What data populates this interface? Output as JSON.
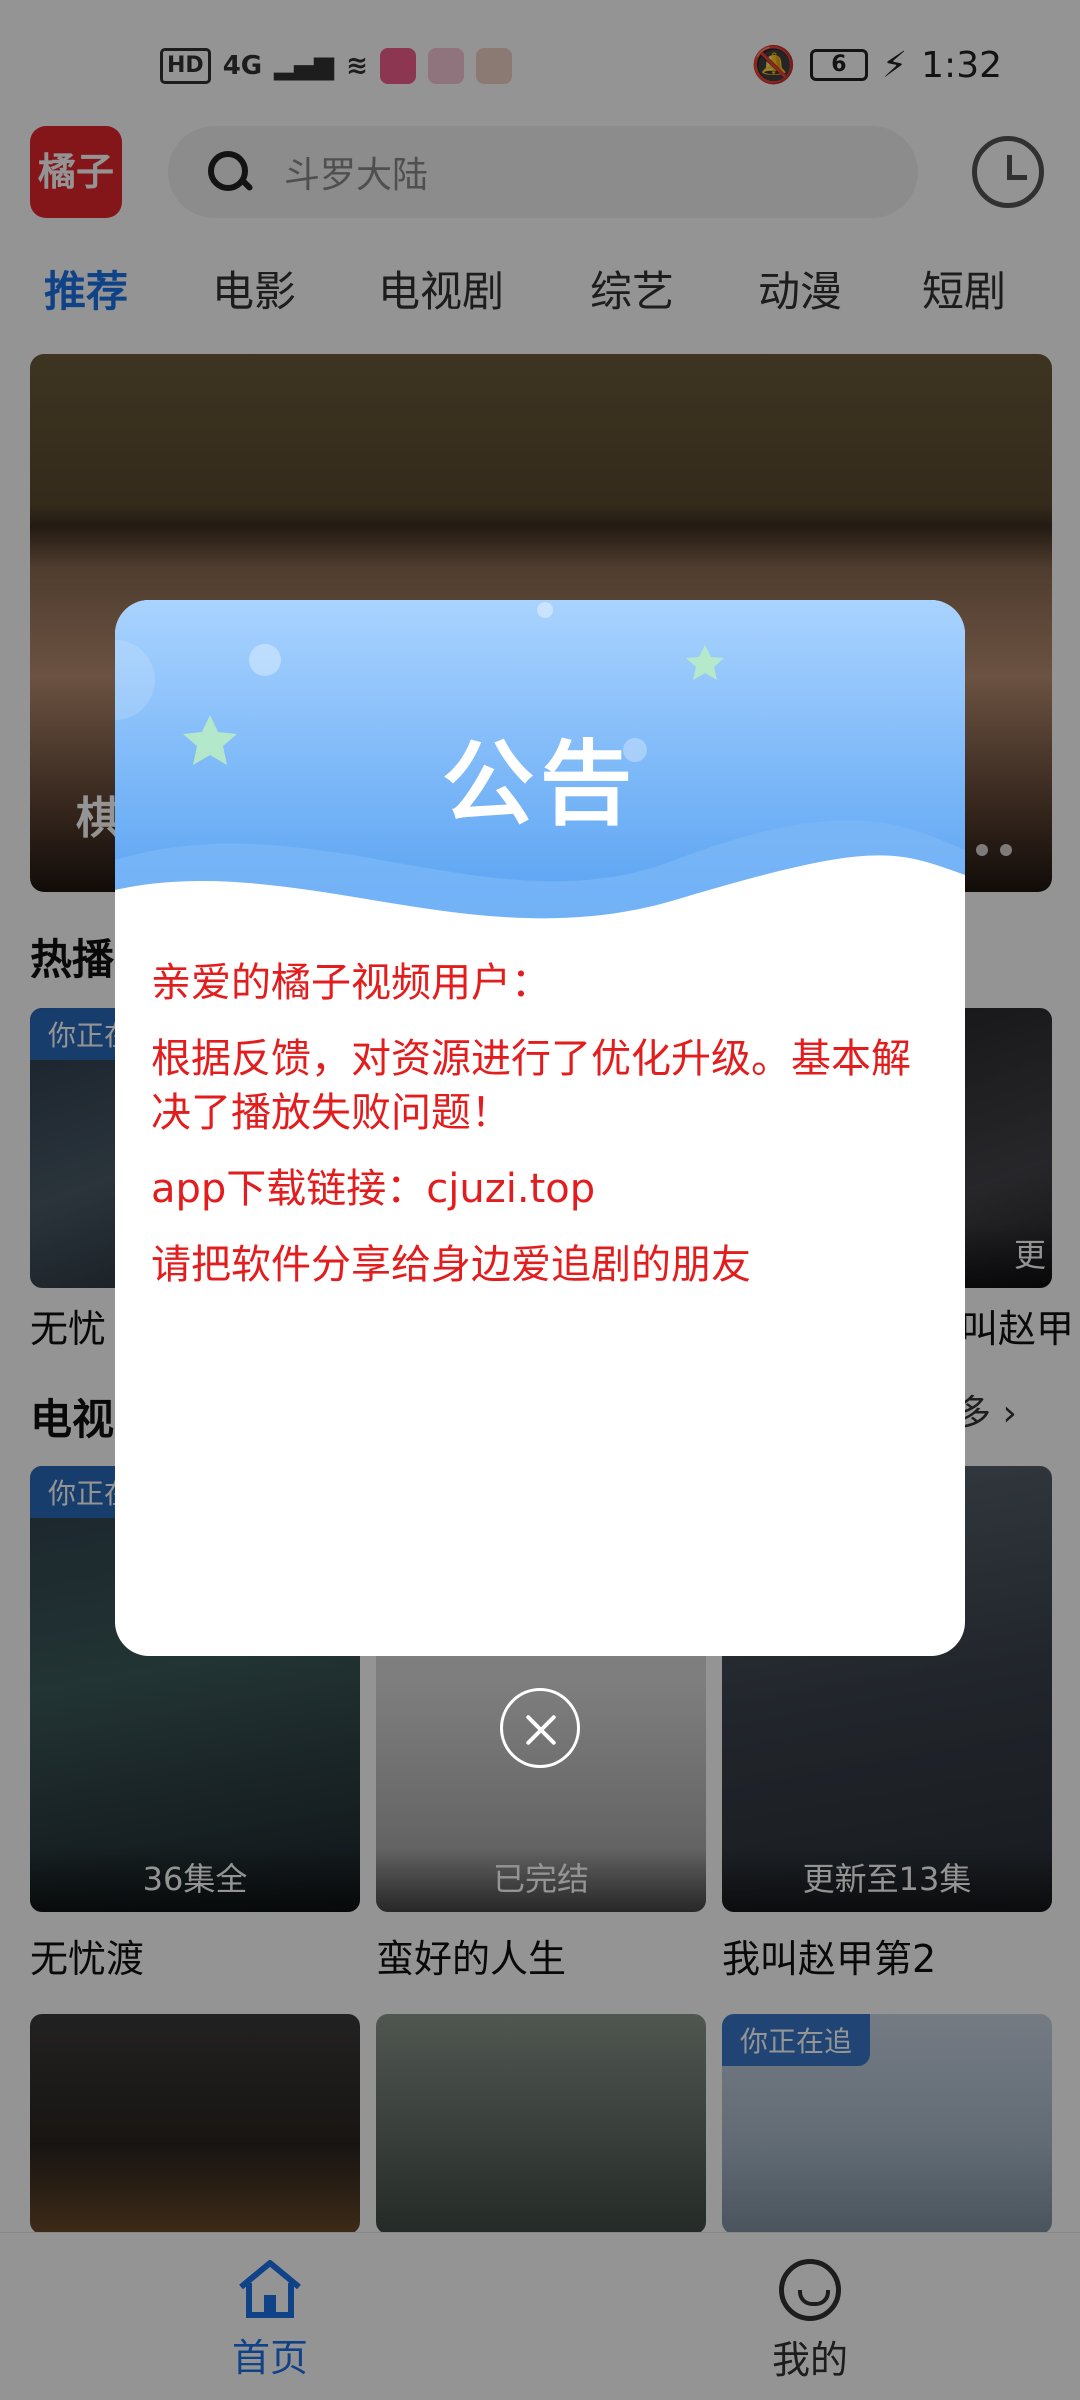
{
  "status_bar": {
    "hd": "HD",
    "signal": "4G",
    "battery": "6",
    "time": "1:32"
  },
  "header": {
    "logo_text": "橘子",
    "search_placeholder": "斗罗大陆"
  },
  "tabs": [
    "推荐",
    "电影",
    "电视剧",
    "综艺",
    "动漫",
    "短剧"
  ],
  "banner": {
    "title": "棋"
  },
  "sections": [
    {
      "title": "热播",
      "more": ""
    },
    {
      "title": "电视",
      "more": "多"
    }
  ],
  "hot_row": {
    "tag": "你正在",
    "left_title": "无忧",
    "right_title": "叫赵甲",
    "right_caption": "更"
  },
  "tv_row": [
    {
      "tag": "你正在",
      "caption": "36集全",
      "title": "无忧渡"
    },
    {
      "tag": "",
      "caption": "已完结",
      "title": "蛮好的人生"
    },
    {
      "tag": "",
      "caption": "更新至13集",
      "title": "我叫赵甲第2"
    }
  ],
  "bottom_row": [
    {
      "tag": ""
    },
    {
      "tag": ""
    },
    {
      "tag": "你正在追"
    }
  ],
  "bottom_nav": [
    {
      "label": "首页",
      "active": true
    },
    {
      "label": "我的",
      "active": false
    }
  ],
  "dialog": {
    "title": "公告",
    "lines": [
      "亲爱的橘子视频用户：",
      "根据反馈，对资源进行了优化升级。基本解决了播放失败问题！",
      "app下载链接：cjuzi.top",
      "请把软件分享给身边爱追剧的朋友"
    ]
  },
  "colors": {
    "accent": "#1a73e8",
    "brand": "#e3262e",
    "notice_text": "#e31d1d"
  }
}
